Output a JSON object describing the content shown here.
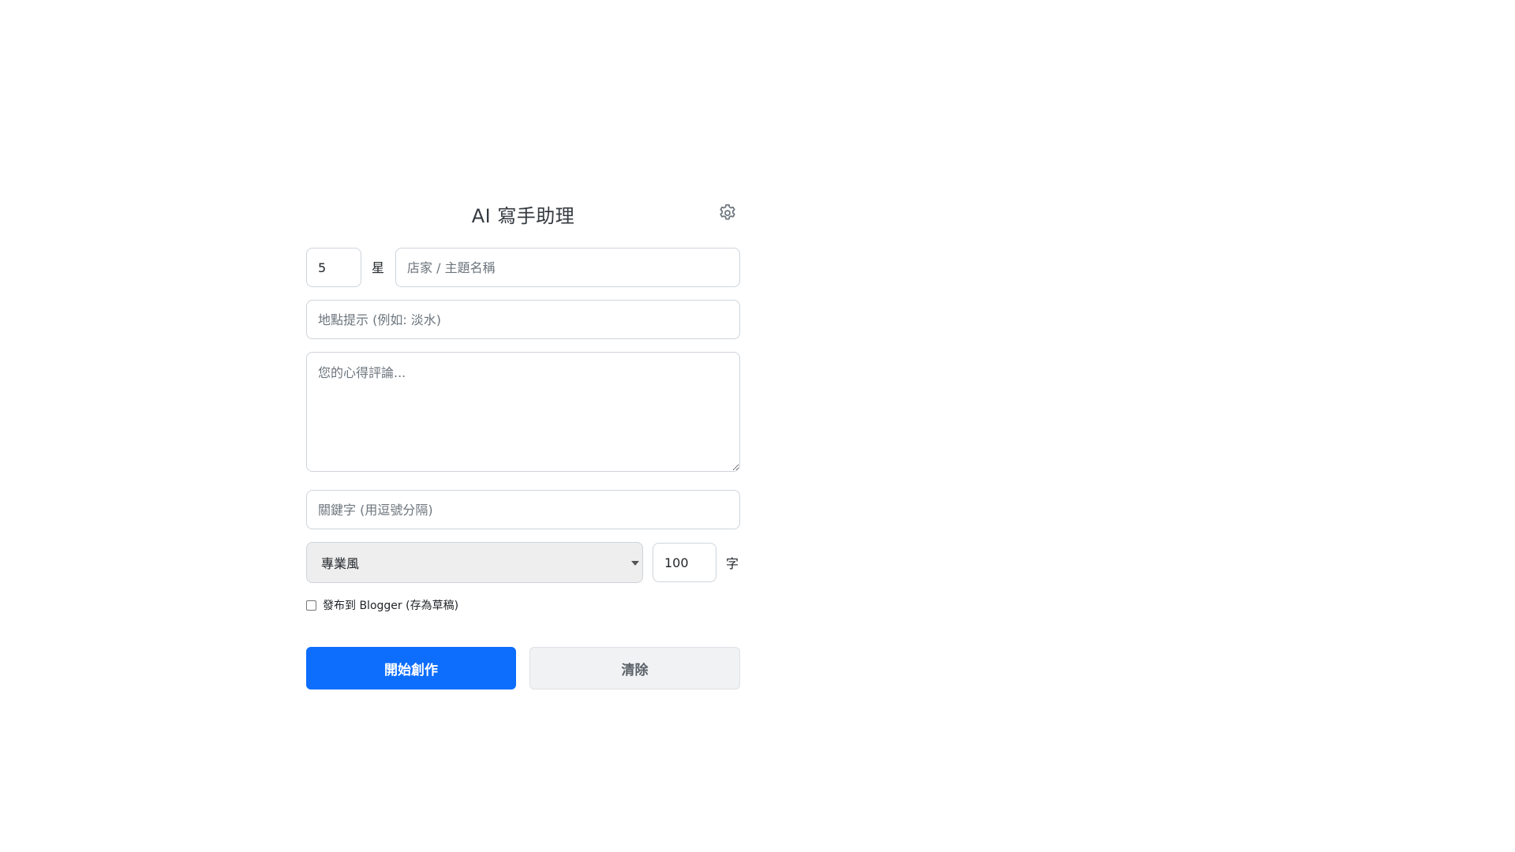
{
  "header": {
    "title": "AI 寫手助理",
    "settings_icon": "gear-icon"
  },
  "rating": {
    "value": "5",
    "suffix": "星"
  },
  "shop": {
    "placeholder": "店家 / 主題名稱",
    "value": ""
  },
  "location": {
    "placeholder": "地點提示 (例如: 淡水)",
    "value": ""
  },
  "review": {
    "placeholder": "您的心得評論...",
    "value": ""
  },
  "keywords": {
    "placeholder": "關鍵字 (用逗號分隔)",
    "value": ""
  },
  "style": {
    "selected": "專業風"
  },
  "word_count": {
    "value": "100",
    "suffix": "字"
  },
  "publish": {
    "label": "發布到 Blogger (存為草稿)",
    "checked": false
  },
  "buttons": {
    "create_label": "開始創作",
    "clear_label": "清除"
  },
  "colors": {
    "primary": "#0d6efd",
    "secondary_bg": "#f1f2f3",
    "select_bg": "#eeeeee",
    "border": "#ced4da"
  }
}
